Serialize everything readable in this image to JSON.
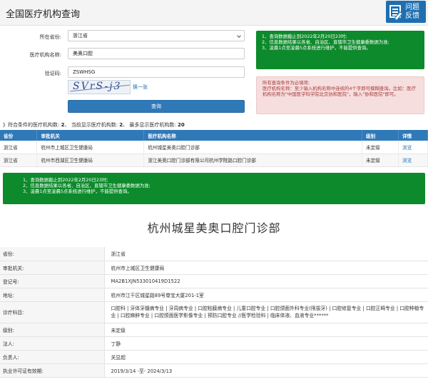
{
  "header": {
    "title": "全国医疗机构查询",
    "feedback_line1": "问题",
    "feedback_line2": "反馈"
  },
  "form": {
    "province_label": "所在省份:",
    "province_value": "浙江省",
    "name_label": "医疗机构名称:",
    "name_value": "美奥口腔",
    "captcha_label": "验证码:",
    "captcha_input": "ZSWHSG",
    "captcha_text": "SVrS-j3",
    "refresh_label": "换一张",
    "query_button": "查询"
  },
  "notes": {
    "green": [
      "1、查询数据截止到2022年2月20日23时;",
      "2、信息数据结果以各省、自治区、直辖市卫生健康委数据为准;",
      "3、凌晨1点至凌晨5点系统进行维护，不能提供查询。"
    ],
    "red": [
      "所有查询条件为必填项;",
      "医疗机构名称：至少输入机构名称中连续的4个字即可模糊查询。比如：医疗机构名称为\"中国医学科学院北京协和医院\"，输入\"协和医院\"即可。"
    ]
  },
  "summary": {
    "prefix": "》符合条件的医疗机构数:",
    "matched": "2",
    "current_label": "、 当前显示医疗机构数:",
    "current": "2",
    "max_label": "、 最多显示医疗机构数:",
    "max": "20"
  },
  "results": {
    "headers": [
      "省份",
      "审批机关",
      "医疗机构名称",
      "级别",
      "详情"
    ],
    "rows": [
      {
        "province": "浙江省",
        "authority": "杭州市上城区卫生健康局",
        "name": "杭州城星美奥口腔门诊部",
        "level": "未定级",
        "detail": "浏览"
      },
      {
        "province": "浙江省",
        "authority": "杭州市西湖区卫生健康局",
        "name": "浙江美奥口腔门诊部有限公司杭州学院路口腔门诊部",
        "level": "未定级",
        "detail": "浏览"
      }
    ]
  },
  "notes2": [
    "1、查询数据截止到2022年2月20日23时;",
    "2、信息数据结果以各省、自治区、直辖市卫生健康委数据为准;",
    "3、凌晨1点至凌晨5点系统进行维护，不能提供查询。"
  ],
  "detail": {
    "title": "杭州城星美奥口腔门诊部",
    "rows": [
      {
        "k": "省份:",
        "v": "浙江省"
      },
      {
        "k": "审批机关:",
        "v": "杭州市上城区卫生健康局"
      },
      {
        "k": "登记号:",
        "v": "MA2B1XJN533010419D1522"
      },
      {
        "k": "地址:",
        "v": "杭州市江干区城星路89号尊宝大厦201-1室"
      },
      {
        "k": "诊疗科目:",
        "v": "口腔科 | 牙体牙髓病专业 | 牙周病专业 | 口腔粘膜病专业 | 儿童口腔专业 | 口腔颌面外科专业(限拔牙) | 口腔修复专业 | 口腔正畸专业 | 口腔种植专业 | 口腔麻醉专业 | 口腔颌面医学影像专业 | 预防口腔专业 //医学检验科 | 临床体液、血液专业******"
      },
      {
        "k": "级别:",
        "v": "未定级"
      },
      {
        "k": "法人:",
        "v": "丁静"
      },
      {
        "k": "负责人:",
        "v": "关显超"
      },
      {
        "k": "执业许可证有效期:",
        "v": "2019/3/14 -至- 2024/3/13"
      }
    ]
  },
  "colors": {
    "brand_blue": "#2f79b9",
    "green": "#0d8a2b",
    "warn_bg": "#f6dede",
    "warn_text": "#a83b3b"
  }
}
